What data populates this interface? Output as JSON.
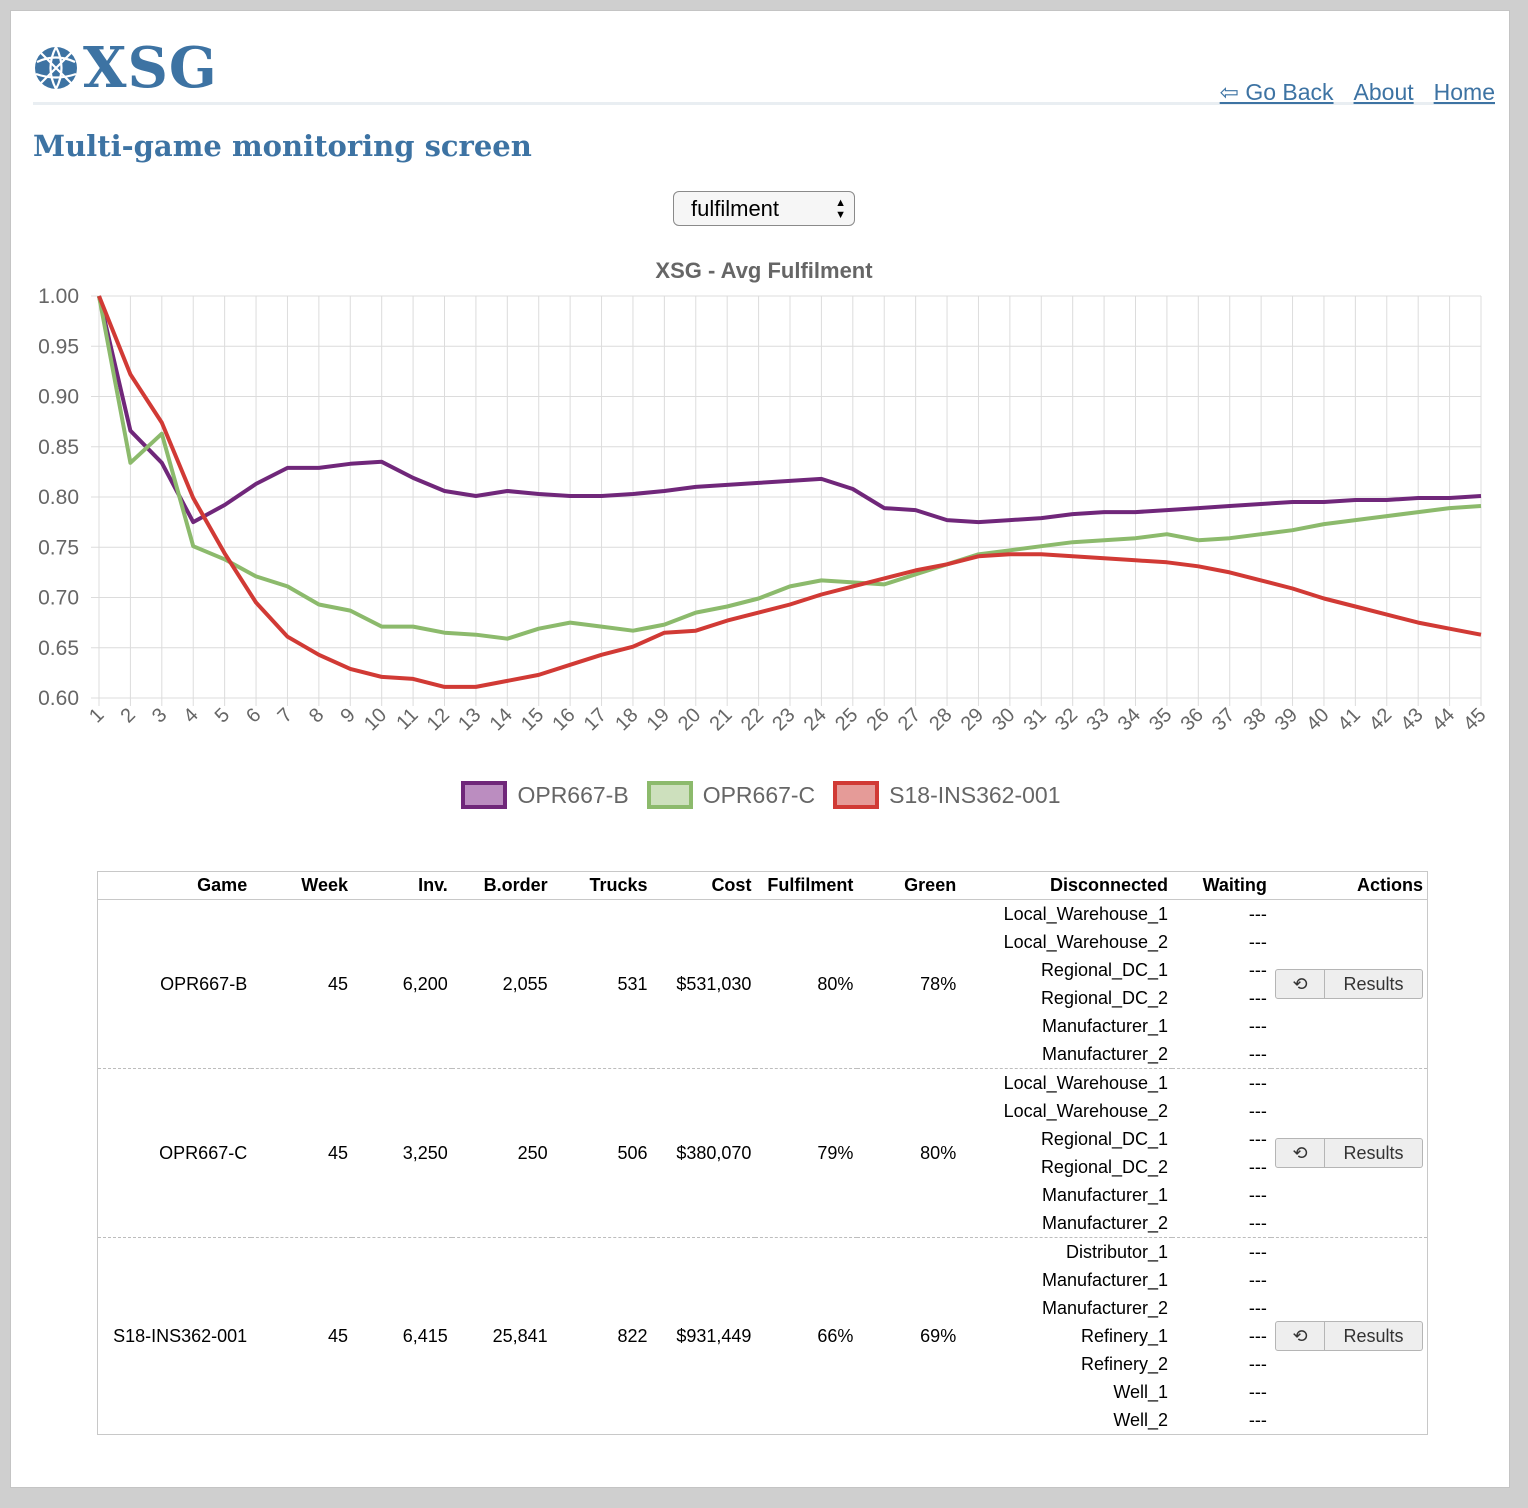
{
  "header": {
    "logo_text": "XSG",
    "nav": {
      "go_back": "⇦ Go Back",
      "about": "About",
      "home": "Home"
    }
  },
  "page_title": "Multi-game monitoring screen",
  "metric_select": {
    "selected": "fulfilment"
  },
  "colors": {
    "accent": "#3d73a3",
    "series": [
      "#70277a",
      "#8cba6c",
      "#d13a35"
    ],
    "series_fill": [
      "#bb8dc0",
      "#cde0bd",
      "#e59b98"
    ]
  },
  "chart_data": {
    "type": "line",
    "title": "XSG - Avg Fulfilment",
    "x": [
      1,
      2,
      3,
      4,
      5,
      6,
      7,
      8,
      9,
      10,
      11,
      12,
      13,
      14,
      15,
      16,
      17,
      18,
      19,
      20,
      21,
      22,
      23,
      24,
      25,
      26,
      27,
      28,
      29,
      30,
      31,
      32,
      33,
      34,
      35,
      36,
      37,
      38,
      39,
      40,
      41,
      42,
      43,
      44,
      45
    ],
    "ylim": [
      0.6,
      1.0
    ],
    "yticks": [
      "1.00",
      "0.95",
      "0.90",
      "0.85",
      "0.80",
      "0.75",
      "0.70",
      "0.65",
      "0.60"
    ],
    "grid": true,
    "legend_position": "bottom",
    "series": [
      {
        "name": "OPR667-B",
        "values": [
          1.0,
          0.866,
          0.834,
          0.775,
          0.792,
          0.813,
          0.829,
          0.829,
          0.833,
          0.835,
          0.819,
          0.806,
          0.801,
          0.806,
          0.803,
          0.801,
          0.801,
          0.803,
          0.806,
          0.81,
          0.812,
          0.814,
          0.816,
          0.818,
          0.808,
          0.789,
          0.787,
          0.777,
          0.775,
          0.777,
          0.779,
          0.783,
          0.785,
          0.785,
          0.787,
          0.789,
          0.791,
          0.793,
          0.795,
          0.795,
          0.797,
          0.797,
          0.799,
          0.799,
          0.801
        ]
      },
      {
        "name": "OPR667-C",
        "values": [
          1.0,
          0.834,
          0.863,
          0.751,
          0.738,
          0.721,
          0.711,
          0.693,
          0.687,
          0.671,
          0.671,
          0.665,
          0.663,
          0.659,
          0.669,
          0.675,
          0.671,
          0.667,
          0.673,
          0.685,
          0.691,
          0.699,
          0.711,
          0.717,
          0.715,
          0.713,
          0.723,
          0.733,
          0.743,
          0.747,
          0.751,
          0.755,
          0.757,
          0.759,
          0.763,
          0.757,
          0.759,
          0.763,
          0.767,
          0.773,
          0.777,
          0.781,
          0.785,
          0.789,
          0.791
        ]
      },
      {
        "name": "S18-INS362-001",
        "values": [
          1.0,
          0.922,
          0.874,
          0.799,
          0.744,
          0.695,
          0.661,
          0.643,
          0.629,
          0.621,
          0.619,
          0.611,
          0.611,
          0.617,
          0.623,
          0.633,
          0.643,
          0.651,
          0.665,
          0.667,
          0.677,
          0.685,
          0.693,
          0.703,
          0.711,
          0.719,
          0.727,
          0.733,
          0.741,
          0.743,
          0.743,
          0.741,
          0.739,
          0.737,
          0.735,
          0.731,
          0.725,
          0.717,
          0.709,
          0.699,
          0.691,
          0.683,
          0.675,
          0.669,
          0.663
        ]
      }
    ]
  },
  "table": {
    "headers": [
      "Game",
      "Week",
      "Inv.",
      "B.order",
      "Trucks",
      "Cost",
      "Fulfilment",
      "Green",
      "Disconnected",
      "Waiting",
      "Actions"
    ],
    "reset_icon": "⟲",
    "results_label": "Results",
    "rows": [
      {
        "game": "OPR667-B",
        "week": "45",
        "inv": "6,200",
        "border": "2,055",
        "trucks": "531",
        "cost": "$531,030",
        "fulfilment": "80%",
        "green": "78%",
        "disconnected": [
          "Local_Warehouse_1",
          "Local_Warehouse_2",
          "Regional_DC_1",
          "Regional_DC_2",
          "Manufacturer_1",
          "Manufacturer_2"
        ],
        "waiting": [
          "---",
          "---",
          "---",
          "---",
          "---",
          "---"
        ]
      },
      {
        "game": "OPR667-C",
        "week": "45",
        "inv": "3,250",
        "border": "250",
        "trucks": "506",
        "cost": "$380,070",
        "fulfilment": "79%",
        "green": "80%",
        "disconnected": [
          "Local_Warehouse_1",
          "Local_Warehouse_2",
          "Regional_DC_1",
          "Regional_DC_2",
          "Manufacturer_1",
          "Manufacturer_2"
        ],
        "waiting": [
          "---",
          "---",
          "---",
          "---",
          "---",
          "---"
        ]
      },
      {
        "game": "S18-INS362-001",
        "week": "45",
        "inv": "6,415",
        "border": "25,841",
        "trucks": "822",
        "cost": "$931,449",
        "fulfilment": "66%",
        "green": "69%",
        "disconnected": [
          "Distributor_1",
          "Manufacturer_1",
          "Manufacturer_2",
          "Refinery_1",
          "Refinery_2",
          "Well_1",
          "Well_2"
        ],
        "waiting": [
          "---",
          "---",
          "---",
          "---",
          "---",
          "---",
          "---"
        ]
      }
    ]
  }
}
